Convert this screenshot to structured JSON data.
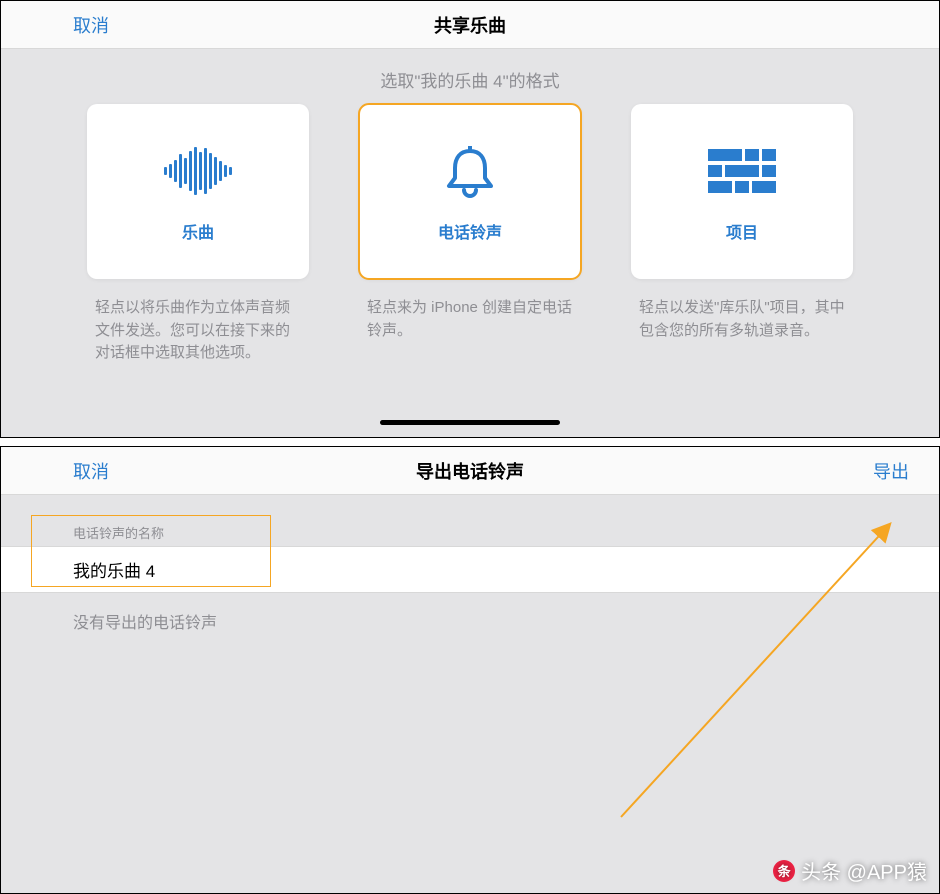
{
  "panel1": {
    "cancel": "取消",
    "title": "共享乐曲",
    "subtitle": "选取\"我的乐曲 4\"的格式",
    "cards": [
      {
        "label": "乐曲",
        "desc": "轻点以将乐曲作为立体声音频文件发送。您可以在接下来的对话框中选取其他选项。"
      },
      {
        "label": "电话铃声",
        "desc": "轻点来为 iPhone 创建自定电话铃声。"
      },
      {
        "label": "项目",
        "desc": "轻点以发送\"库乐队\"项目，其中包含您的所有多轨道录音。"
      }
    ]
  },
  "panel2": {
    "cancel": "取消",
    "title": "导出电话铃声",
    "export": "导出",
    "field_label": "电话铃声的名称",
    "field_value": "我的乐曲 4",
    "note": "没有导出的电话铃声"
  },
  "watermark": "头条 @APP猿"
}
